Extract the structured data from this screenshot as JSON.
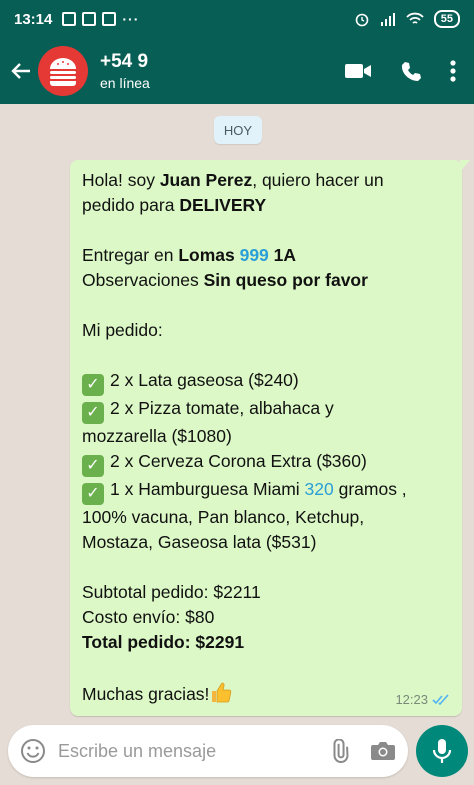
{
  "statusbar": {
    "time": "13:14",
    "battery": "55"
  },
  "header": {
    "name": "+54 9",
    "status": "en línea"
  },
  "chat": {
    "date_chip": "HOY",
    "message": {
      "l1_a": "Hola! soy ",
      "l1_b": "Juan Perez",
      "l1_c": ", quiero hacer un",
      "l2_a": "pedido para ",
      "l2_b": "DELIVERY",
      "l3_a": "Entregar en ",
      "l3_b": "Lomas ",
      "l3_c": "999",
      "l3_d": " 1A",
      "l4_a": "Observaciones ",
      "l4_b": "Sin queso por favor",
      "l5": "Mi pedido:",
      "item1": "2 x Lata gaseosa   ($240)",
      "item2_a": "2 x Pizza tomate, albahaca y",
      "item2_b": "mozzarella   ($1080)",
      "item3": "2 x Cerveza Corona Extra   ($360)",
      "item4_a": "1 x Hamburguesa Miami ",
      "item4_b": "320",
      "item4_c": " gramos ,",
      "item4_d": "100% vacuna, Pan blanco, Ketchup,",
      "item4_e": "Mostaza, Gaseosa lata ($531)",
      "subtotal": "Subtotal pedido: $2211",
      "envio": "Costo envío: $80",
      "total": "Total pedido: $2291",
      "thanks": "Muchas gracias!",
      "time": "12:23"
    }
  },
  "input": {
    "placeholder": "Escribe un mensaje"
  },
  "icons": {
    "back": "arrow-left-icon",
    "video": "video-call-icon",
    "call": "phone-icon",
    "menu": "more-vert-icon",
    "emoji": "emoji-icon",
    "attach": "paperclip-icon",
    "camera": "camera-icon",
    "mic": "microphone-icon",
    "check": "checkmark-icon",
    "ticks": "double-check-icon",
    "thumb": "thumbs-up-icon"
  },
  "colors": {
    "header": "#075e54",
    "bubble": "#dcf8c6",
    "mic": "#00897b",
    "highlight": "#2a9fd8"
  }
}
